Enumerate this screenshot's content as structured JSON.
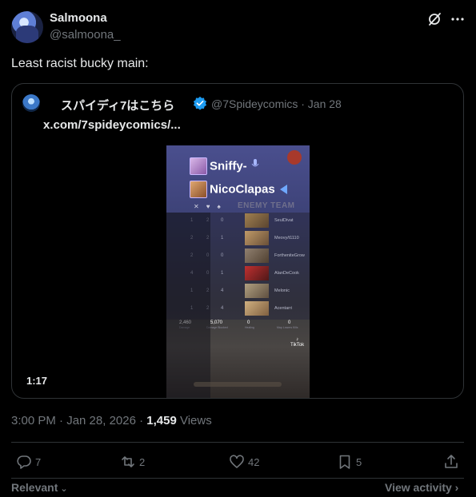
{
  "author": {
    "display_name": "Salmoona",
    "handle": "@salmoona_"
  },
  "tweet": {
    "text": "Least racist bucky main:"
  },
  "quote": {
    "display_name": "スパイディ7はこちら",
    "handle_date": "@7Spideycomics · Jan 28",
    "link": "x.com/7spideycomics/..."
  },
  "video": {
    "duration": "1:17",
    "players": [
      "Sniffy-",
      "NicoClapas"
    ],
    "enemy_label": "ENEMY TEAM",
    "enemy_names": [
      "SeulDivat",
      "Meovy/t1110",
      "FortheniteGrow",
      "AlanDeCook",
      "Melonic",
      "Acentarri"
    ],
    "rows": [
      [
        "1",
        "2",
        "0"
      ],
      [
        "2",
        "2",
        "1"
      ],
      [
        "2",
        "0",
        "0"
      ],
      [
        "4",
        "0",
        "1"
      ],
      [
        "1",
        "2",
        "4"
      ],
      [
        "1",
        "2",
        "4"
      ]
    ],
    "stats": [
      "2,460",
      "5,070",
      "0",
      "0"
    ],
    "stat_labels": [
      "Damage",
      "Damage Blocked",
      "Healing",
      "Map Lowers Kills"
    ],
    "watermark": "TikTok"
  },
  "meta": {
    "time": "3:00 PM · Jan 28, 2026 · ",
    "views_count": "1,459",
    "views_label": " Views"
  },
  "actions": {
    "replies": "7",
    "reposts": "2",
    "likes": "42",
    "bookmarks": "5"
  },
  "footer": {
    "relevant": "Relevant",
    "view_activity": "View activity"
  },
  "colors": {
    "background": "#000000",
    "text": "#e7e9ea",
    "muted": "#71767b",
    "border": "#2f3336",
    "verified": "#1d9bf0"
  }
}
